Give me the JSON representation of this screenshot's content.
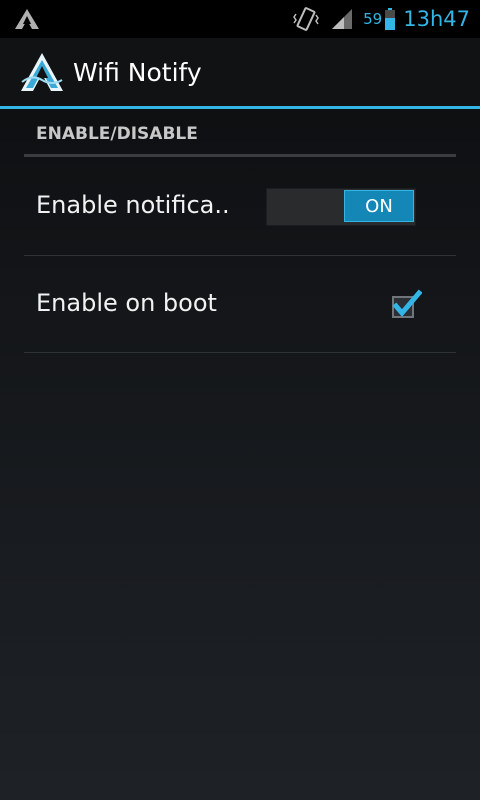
{
  "status_bar": {
    "battery_level": "59",
    "time": "13h47",
    "icons": [
      "app-icon",
      "vibrate-icon",
      "signal-icon",
      "battery-icon"
    ]
  },
  "action_bar": {
    "title": "Wifi Notify",
    "logo": "app-logo-icon"
  },
  "preferences": {
    "category": "ENABLE/DISABLE",
    "items": [
      {
        "label": "Enable notifica..",
        "control": "toggle",
        "state_label": "ON"
      },
      {
        "label": "Enable on boot",
        "control": "checkbox",
        "checked": "true"
      }
    ]
  },
  "colors": {
    "accent": "#33b5e5",
    "toggle_on": "#1487b6",
    "background": "#131518"
  }
}
